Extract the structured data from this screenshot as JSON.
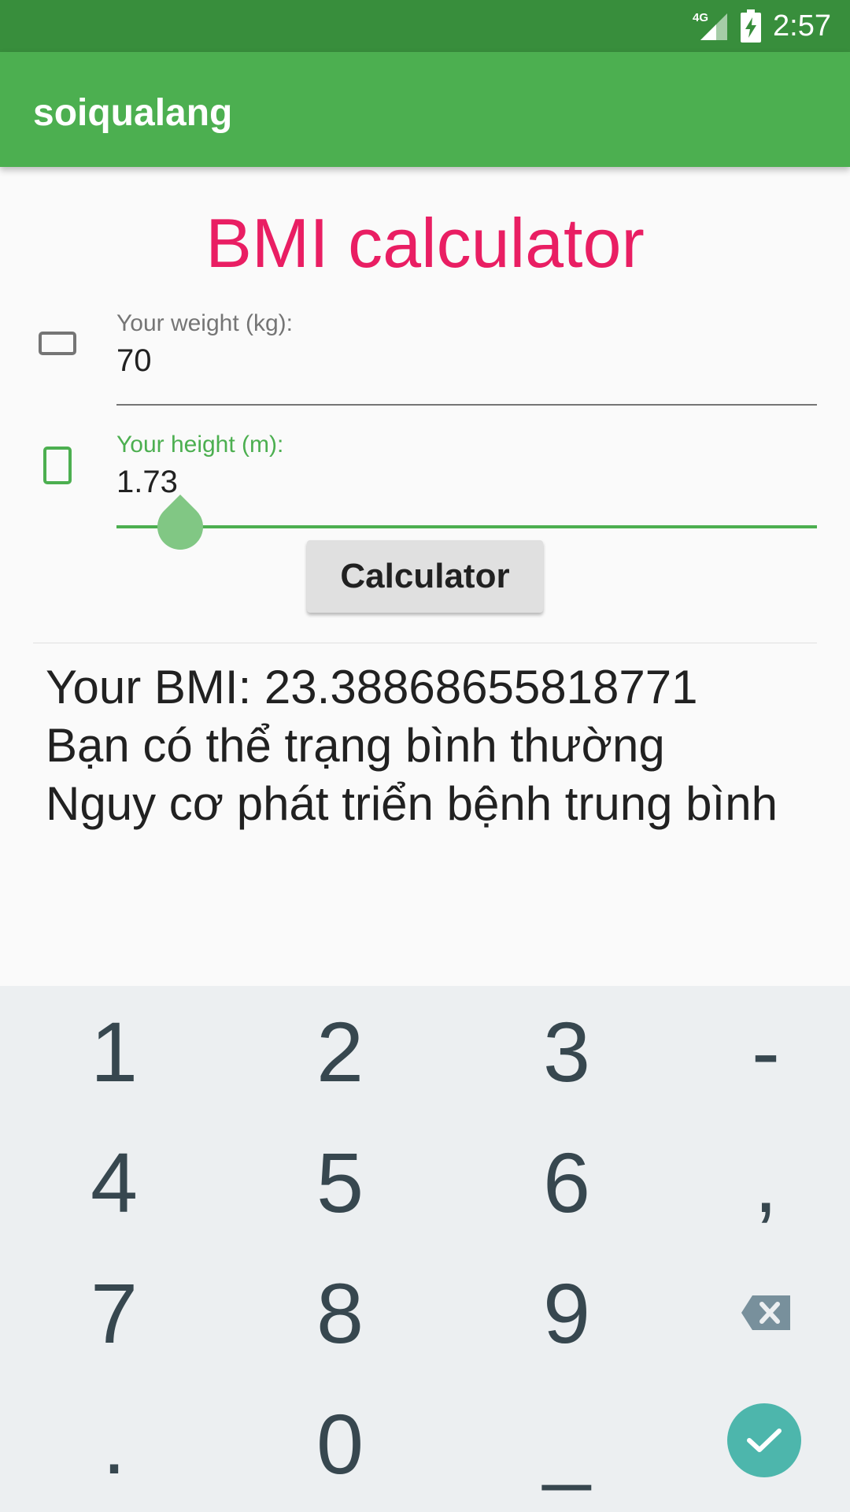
{
  "status_bar": {
    "network": "4G",
    "time": "2:57",
    "icons": [
      "signal-icon",
      "battery-charging-icon"
    ]
  },
  "app_bar": {
    "title": "soiqualang"
  },
  "main": {
    "title": "BMI calculator",
    "weight": {
      "label": "Your weight (kg):",
      "value": "70"
    },
    "height": {
      "label": "Your height (m):",
      "value": "1.73"
    },
    "calculate_button": "Calculator",
    "result": {
      "line1": "Your BMI: 23.38868655818771",
      "line2": "Bạn có thể trạng bình thường",
      "line3": "Nguy cơ phát triển bệnh trung bình"
    }
  },
  "keyboard": {
    "rows": [
      [
        "1",
        "2",
        "3",
        "-"
      ],
      [
        "4",
        "5",
        "6",
        ","
      ],
      [
        "7",
        "8",
        "9",
        "backspace-icon"
      ],
      [
        ".",
        "0",
        "_",
        "enter-check-icon"
      ]
    ]
  },
  "colors": {
    "status_bar": "#388e3c",
    "app_bar": "#4caf50",
    "title": "#e91e63",
    "focus": "#4caf50",
    "keyboard_bg": "#eceff1",
    "enter_key": "#4db6ac"
  }
}
